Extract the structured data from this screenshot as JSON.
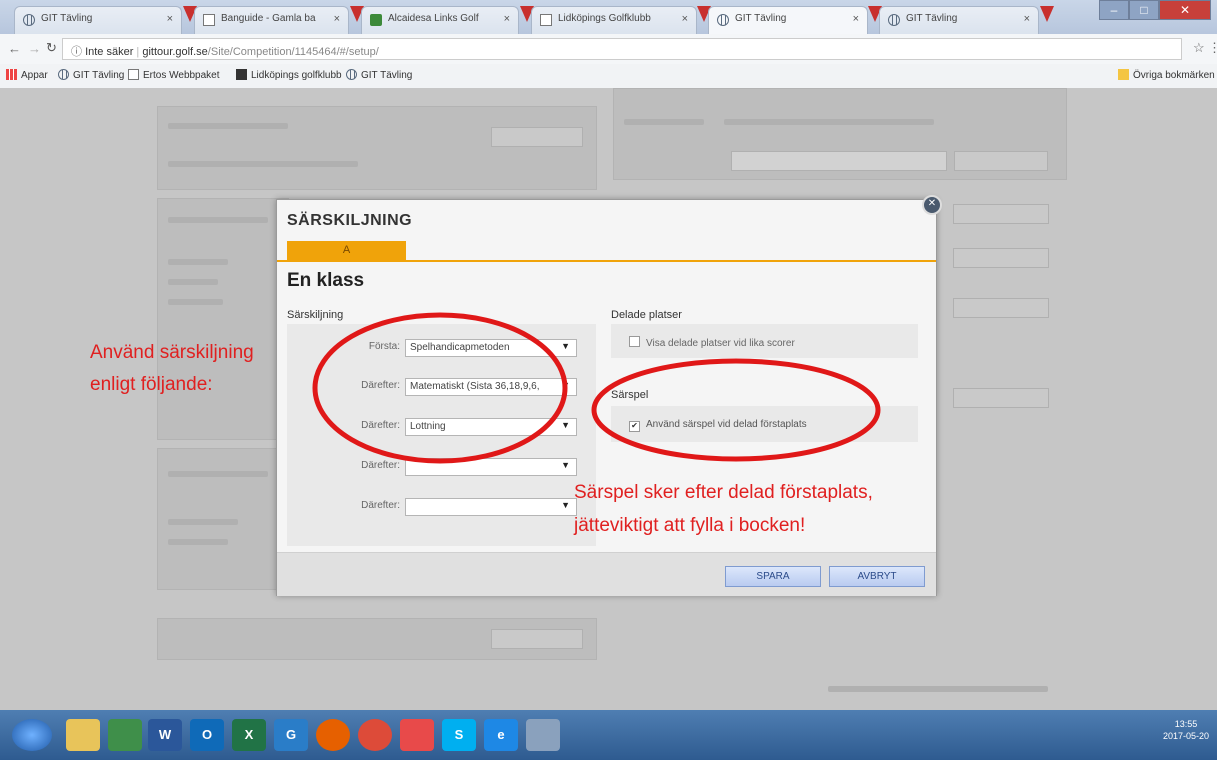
{
  "browser": {
    "tabs": [
      {
        "title": "GIT Tävling"
      },
      {
        "title": "Banguide - Gamla ba"
      },
      {
        "title": "Alcaidesa Links Golf"
      },
      {
        "title": "Lidköpings Golfklubb"
      },
      {
        "title": "GIT Tävling"
      },
      {
        "title": "GIT Tävling"
      }
    ],
    "url_security": "Inte säker",
    "url_host": "gittour.golf.se",
    "url_path": "/Site/Competition/1145464/#/setup/",
    "bookmarks": [
      {
        "label": "Appar"
      },
      {
        "label": "GIT Tävling"
      },
      {
        "label": "Ertos Webbpaket"
      },
      {
        "label": "Lidköpings golfklubb"
      },
      {
        "label": "GIT Tävling"
      }
    ],
    "other_bookmarks": "Övriga bokmärken"
  },
  "modal": {
    "title": "SÄRSKILJNING",
    "tab_label": "A",
    "heading": "En klass",
    "left_section_title": "Särskiljning",
    "rows": [
      {
        "label": "Första:",
        "value": "Spelhandicapmetoden"
      },
      {
        "label": "Därefter:",
        "value": "Matematiskt (Sista 36,18,9,6,"
      },
      {
        "label": "Därefter:",
        "value": "Lottning"
      },
      {
        "label": "Därefter:",
        "value": ""
      },
      {
        "label": "Därefter:",
        "value": ""
      }
    ],
    "shared_title": "Delade platser",
    "shared_checkbox_label": "Visa delade platser vid lika scorer",
    "shared_checked": false,
    "playoff_title": "Särspel",
    "playoff_checkbox_label": "Använd särspel vid delad förstaplats",
    "playoff_checked": true,
    "save_label": "SPARA",
    "cancel_label": "AVBRYT"
  },
  "annotations": {
    "left_line1": "Använd särskiljning",
    "left_line2": "enligt följande:",
    "right_line1": "Särspel sker efter delad förstaplats,",
    "right_line2": "jätteviktigt att fylla i bocken!"
  },
  "taskbar": {
    "time": "13:55",
    "date": "2017-05-20"
  },
  "colors": {
    "accent": "#f0a30a",
    "annotation": "#e02020",
    "button": "#b9cbf0"
  }
}
